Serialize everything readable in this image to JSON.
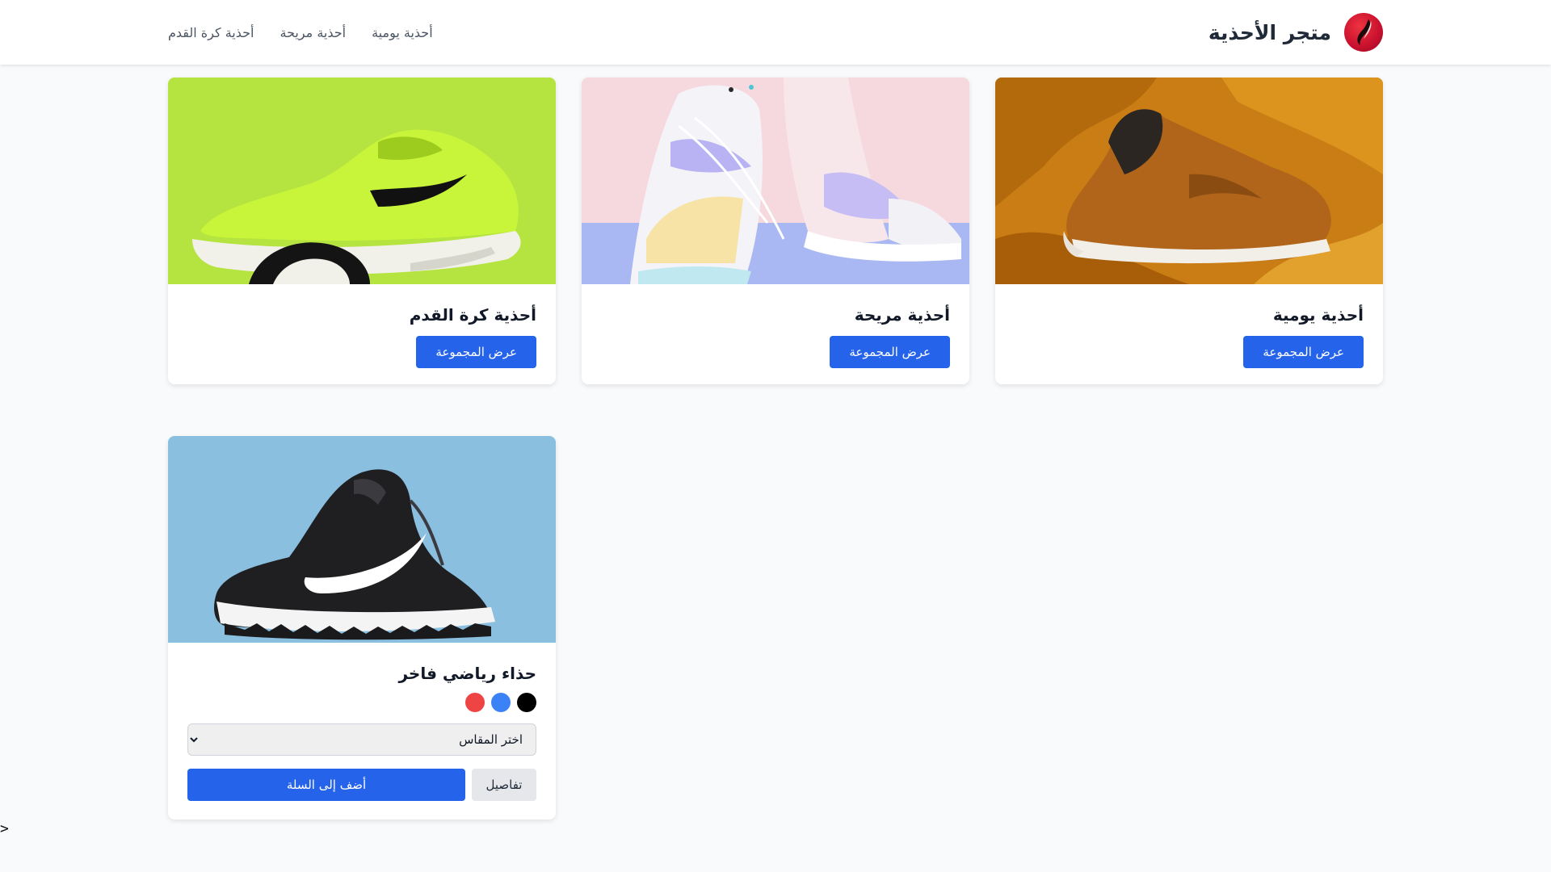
{
  "header": {
    "brand_title": "متجر الأحذية",
    "nav": [
      "أحذية يومية",
      "أحذية مريحة",
      "أحذية كرة القدم"
    ]
  },
  "collections": [
    {
      "title": "أحذية يومية",
      "button_label": "عرض المجموعة",
      "image": "brown-casual-sneaker-on-mustard-fabric"
    },
    {
      "title": "أحذية مريحة",
      "button_label": "عرض المجموعة",
      "image": "pastel-sneakers-on-pink-blue"
    },
    {
      "title": "أحذية كرة القدم",
      "button_label": "عرض المجموعة",
      "image": "neon-green-trainer-on-lime"
    }
  ],
  "product": {
    "title": "حذاء رياضي فاخر",
    "image": "black-basketball-shoe-on-sky-blue",
    "colors": [
      "#000000",
      "#3b82f6",
      "#ef4444"
    ],
    "size_placeholder": "اختر المقاس",
    "details_label": "تفاصيل",
    "add_to_cart_label": "أضف إلى السلة"
  },
  "stray_text": ">",
  "colors": {
    "primary": "#2563eb",
    "logo": "#c8102e",
    "background": "#f9fafb"
  }
}
